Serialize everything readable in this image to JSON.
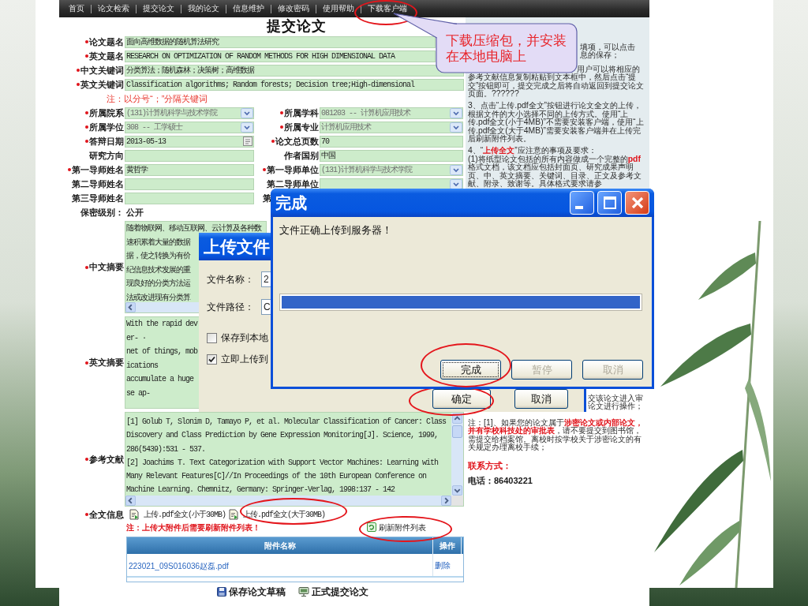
{
  "nav": [
    {
      "label": "首页",
      "circled": false
    },
    {
      "label": "论文检索",
      "circled": false
    },
    {
      "label": "提交论文",
      "circled": false
    },
    {
      "label": "我的论文",
      "circled": false
    },
    {
      "label": "信息维护",
      "circled": false
    },
    {
      "label": "修改密码",
      "circled": false
    },
    {
      "label": "使用帮助",
      "circled": false
    },
    {
      "label": "下载客户端",
      "circled": true
    }
  ],
  "title": "提交论文",
  "form": [
    {
      "kind": "wide",
      "required": true,
      "label": "论文题名",
      "value": "面向高维数据的随机算法研究"
    },
    {
      "kind": "wide",
      "required": true,
      "label": "英文题名",
      "value": "RESEARCH ON OPTIMIZATION OF RANDOM METHODS FOR HIGH DIMENSIONAL DATA"
    },
    {
      "kind": "wide",
      "required": true,
      "label": "中文关键词",
      "value": "分类算法；随机森林；决策树；高维数据"
    },
    {
      "kind": "wide",
      "required": true,
      "label": "英文关键词",
      "value": "Classification algorithms; Random forests; Decision tree;High-dimensional"
    },
    {
      "kind": "note",
      "text": "注：以分号“；”分隔关键词"
    },
    {
      "kind": "pair",
      "cells": [
        {
          "kind": "select",
          "required": true,
          "label": "所属院系",
          "value": "(131)计算机科学与技术学院"
        },
        {
          "kind": "select",
          "required": true,
          "label": "所属学科",
          "value": "081203 -- 计算机应用技术"
        }
      ]
    },
    {
      "kind": "pair",
      "cells": [
        {
          "kind": "select",
          "required": true,
          "label": "所属学位",
          "value": "308 -- 工学硕士"
        },
        {
          "kind": "select",
          "required": true,
          "label": "所属专业",
          "value": "计算机应用技术"
        }
      ]
    },
    {
      "kind": "pair",
      "cells": [
        {
          "kind": "date",
          "required": true,
          "label": "答辩日期",
          "value": "2013-05-13"
        },
        {
          "kind": "text",
          "required": true,
          "label": "论文总页数",
          "value": "70"
        }
      ]
    },
    {
      "kind": "pair",
      "cells": [
        {
          "kind": "text",
          "required": false,
          "label": "研究方向"
        },
        {
          "kind": "text",
          "required": false,
          "label": "作者国别",
          "value": "中国"
        }
      ]
    },
    {
      "kind": "pair",
      "cells": [
        {
          "kind": "text",
          "required": true,
          "label": "第一导师姓名",
          "value": "黄哲学"
        },
        {
          "kind": "select",
          "required": true,
          "label": "第一导师单位",
          "value": "(131)计算机科学与技术学院"
        }
      ]
    },
    {
      "kind": "pair",
      "cells": [
        {
          "kind": "text",
          "required": false,
          "label": "第二导师姓名"
        },
        {
          "kind": "select",
          "required": false,
          "label": "第二导师单位"
        }
      ]
    },
    {
      "kind": "pair",
      "cells": [
        {
          "kind": "text",
          "required": false,
          "label": "第三导师姓名"
        },
        {
          "kind": "covered",
          "label": "第"
        }
      ]
    },
    {
      "kind": "static",
      "label": "保密级别：",
      "value": "公开"
    },
    {
      "kind": "textarea",
      "required": true,
      "label": "中文摘要",
      "horizontal_scrollbar": true,
      "lines": [
        "随着物联网、移动互联网、云计算及各种数",
        "速积累着大量的数据",
        "据，使之转换为有价",
        "纪信息技术发展的重",
        "现良好的分类方法运",
        "法或改进现有分类算"
      ]
    },
    {
      "kind": "textarea",
      "required": true,
      "label": "英文摘要",
      "lines": [
        "With the rapid dev",
        "er- ·",
        "net of things, mob",
        "ications",
        "accumulate a huge",
        "se ap-"
      ]
    },
    {
      "kind": "textarea",
      "required": true,
      "label": "参考文献",
      "horizontal_scrollbar": true,
      "vertical_scrollbar": true,
      "lines": [
        "[1] Golub T, Slonim D, Tamayo P, et al. Molecular Classification of Cancer: Class",
        "Discovery and Class Prediction by Gene Expression Monitoring[J]. Science, 1999,",
        "286(5439):531 - 537.",
        "[2] Joachims T. Text Categorization with Support Vector Machines: Learning with",
        "Many Relevant Features[C]//In Proceedings of the 10th European Conference on",
        "Machine Learning. Chemnitz, Germany: Springer-Verlag, 1998:137 - 142"
      ]
    },
    {
      "kind": "files",
      "required": true,
      "label": "全文信息",
      "links": [
        {
          "label": "上传.pdf全文(小于30MB)",
          "circled": false
        },
        {
          "label": "上传.pdf全文(大于30MB)",
          "circled": true
        }
      ]
    },
    {
      "kind": "refresh",
      "note": "注：上传大附件后需要刷新附件列表！",
      "link": {
        "label": "刷新附件列表",
        "circled": true
      }
    }
  ],
  "attachments": {
    "columns": [
      "附件名称",
      "操作"
    ],
    "rows": [
      {
        "file": "223021_09S016036赵磊.pdf",
        "action": "删除"
      }
    ]
  },
  "actions": [
    "保存论文草稿",
    "正式提交论文"
  ],
  "help": {
    "fragments": [
      "填项，可以点击",
      "息的保存；"
    ],
    "sections": [
      [
        "用户可以将相应的参考文献信息复制粘贴到文本框中，然后点击“提交”按钮即可，提交完成之后将自动返回到提交论文页面。??????"
      ],
      [
        "3、点击“上传.pdf全文”按钮进行论文全文的上传，根据文件的大小选择不同的上传方式。使用“上传.pdf全文(小于4MB)”不需要安装客户端，使用“上传.pdf全文(大于4MB)”需要安装客户端并在上传完后刷新附件列表。"
      ],
      [
        "4、“**上传全文**”应注意的事项及要求：",
        "(1)将纸型论文包括的所有内容做成一个完整的**pdf**格式文档，该文档应包括封面页、研究成果声明页、中、英文摘要、关键词、目录、正文及参考文献、附录、致谢等。具体格式要求请参"
      ]
    ],
    "tail_fragments": [
      "交该论文进入审",
      "论文进行操作；"
    ],
    "notice": "注：[1]、如果您的论文属于**涉密论文或内部论文，并有学校科技处的审批表**，请不要提交到图书馆，需提交给档案馆。离校时按学校关于涉密论文的有关规定办理离校手续；",
    "contact_heading": "联系方式：",
    "phone": "电话：86403221"
  },
  "callout": {
    "text": "下载压缩包，并安装在本地电脑上"
  },
  "upload_dialog": {
    "title": "上传文件",
    "fields": [
      {
        "label": "文件名称：",
        "value": "2"
      },
      {
        "label": "文件路径：",
        "value": "C"
      }
    ],
    "options": [
      {
        "label": "保存到本地",
        "checked": false
      },
      {
        "label": "立即上传到",
        "checked": true
      }
    ],
    "buttons": [
      {
        "label": "确定",
        "circled": true
      },
      {
        "label": "取消",
        "circled": false
      }
    ]
  },
  "done_dialog": {
    "title": "完成",
    "message": "文件正确上传到服务器！",
    "progress": {
      "level": 1
    },
    "buttons": [
      {
        "label": "完成",
        "disabled": false,
        "focused": true,
        "circled": true
      },
      {
        "label": "暂停",
        "disabled": true,
        "focused": false,
        "circled": false
      },
      {
        "label": "取消",
        "disabled": true,
        "focused": false,
        "circled": false
      }
    ]
  }
}
